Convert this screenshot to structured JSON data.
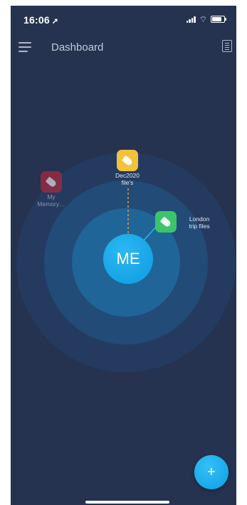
{
  "status_bar": {
    "time": "16:06",
    "location_glyph": "➚",
    "wifi_glyph": "⌔"
  },
  "header": {
    "title": "Dashboard"
  },
  "center": {
    "label": "ME"
  },
  "folders": [
    {
      "label_line1": "Dec2020",
      "label_line2": "file's",
      "color": "#f2c23a",
      "ring": "inner-top"
    },
    {
      "label_line1": "London",
      "label_line2": "trip files",
      "color": "#3cc46a",
      "ring": "inner-right"
    },
    {
      "label_line1": "My",
      "label_line2": "Memory…",
      "color": "#b7283d",
      "ring": "outer-left",
      "faded": true
    }
  ],
  "fab": {
    "label": "+"
  },
  "colors": {
    "background": "#253250",
    "accent": "#1aa5e8"
  },
  "icons": [
    "menu-icon",
    "notes-icon",
    "tag-icon",
    "plus-icon"
  ]
}
